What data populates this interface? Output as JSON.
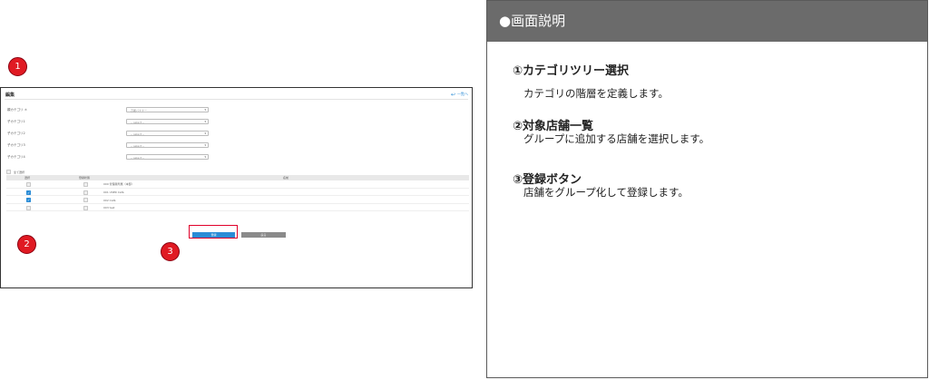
{
  "screenshot": {
    "title": "編集",
    "back_label": "一覧へ",
    "fields": [
      {
        "label": "親カテゴリ ＊",
        "value": "万能バナナー"
      },
      {
        "label": "子カテゴリ1",
        "value": "-- select --"
      },
      {
        "label": "子カテゴリ2",
        "value": "-- select --"
      },
      {
        "label": "子カテゴリ3",
        "value": "-- select --"
      },
      {
        "label": "子カテゴリ4",
        "value": "-- select --"
      }
    ],
    "select_all_label": "全て選択",
    "table_headers": [
      "選択",
      "登録状態",
      "名前"
    ],
    "rows": [
      {
        "checked": false,
        "registered": false,
        "name": "000 管理者所属（本部）"
      },
      {
        "checked": true,
        "registered": false,
        "name": "001 USER Café"
      },
      {
        "checked": true,
        "registered": false,
        "name": "002 Café"
      },
      {
        "checked": false,
        "registered": false,
        "name": "003 test"
      }
    ],
    "register_button": "登録",
    "back_button": "戻る",
    "markers": [
      "1",
      "2",
      "3"
    ]
  },
  "panel": {
    "header": "●画面説明",
    "items": [
      {
        "title": "①カテゴリツリー選択",
        "desc": "カテゴリの階層を定義します。"
      },
      {
        "title": "②対象店舗一覧",
        "desc": "グループに追加する店舗を選択します。"
      },
      {
        "title": "③登録ボタン",
        "desc": "店舗をグループ化して登録します。"
      }
    ]
  },
  "colors": {
    "accent": "#2a8cd6",
    "marker": "#e01a23",
    "panel_header": "#6b6b6b",
    "highlight": "#e0002a",
    "secondary_button": "#8a8a8a"
  }
}
